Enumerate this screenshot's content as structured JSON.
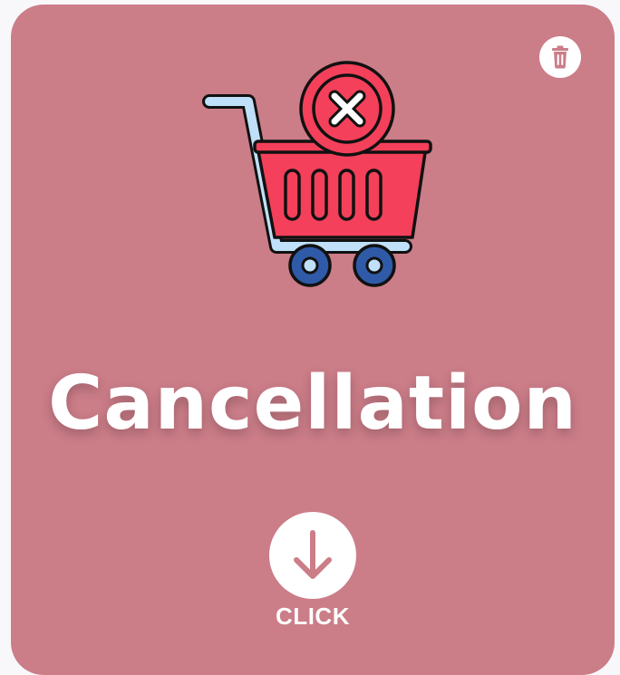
{
  "card": {
    "title": "Cancellation",
    "click_label": "CLICK",
    "background_color": "#cb7d88"
  },
  "icons": {
    "trash": "trash-icon",
    "illustration": "shopping-cart-cancel-icon",
    "download": "arrow-down-icon"
  },
  "colors": {
    "cart_red": "#f4405a",
    "cart_handle": "#bfe0f8",
    "wheel_blue": "#2f5aa8",
    "outline": "#111111"
  }
}
